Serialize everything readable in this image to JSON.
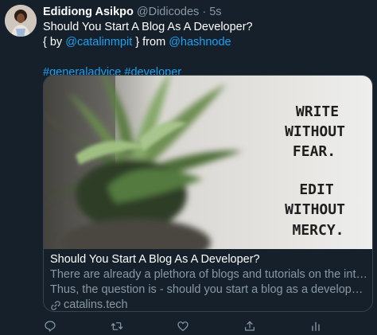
{
  "tweet": {
    "author_name": "Edidiong Asikpo",
    "author_handle": "@Didicodes",
    "separator": "·",
    "time": "5s",
    "line1": "Should You Start A Blog As A Developer?",
    "line2_prefix": "{ by ",
    "mention1": "@catalinmpit",
    "line2_mid": " } from ",
    "mention2": "@hashnode",
    "hashtag1": "#generaladvice",
    "hashtag_space": " ",
    "hashtag2": "#developer"
  },
  "card": {
    "image_lines": [
      "WRITE",
      "WITHOUT",
      "FEAR.",
      "EDIT",
      "WITHOUT",
      "MERCY."
    ],
    "title": "Should You Start A Blog As A Developer?",
    "description_line1": "There are already a plethora of blogs and tutorials on the internet.",
    "description_line2": "Thus, the question is - should you start a blog as a developer? The ...",
    "domain": "catalins.tech"
  },
  "actions": [
    "reply-icon",
    "retweet-icon",
    "like-icon",
    "share-icon",
    "analytics-icon"
  ],
  "colors": {
    "background": "#15202b",
    "text": "#ffffff",
    "secondary": "#8899a6",
    "link": "#1da1f2",
    "border": "#38444d"
  }
}
